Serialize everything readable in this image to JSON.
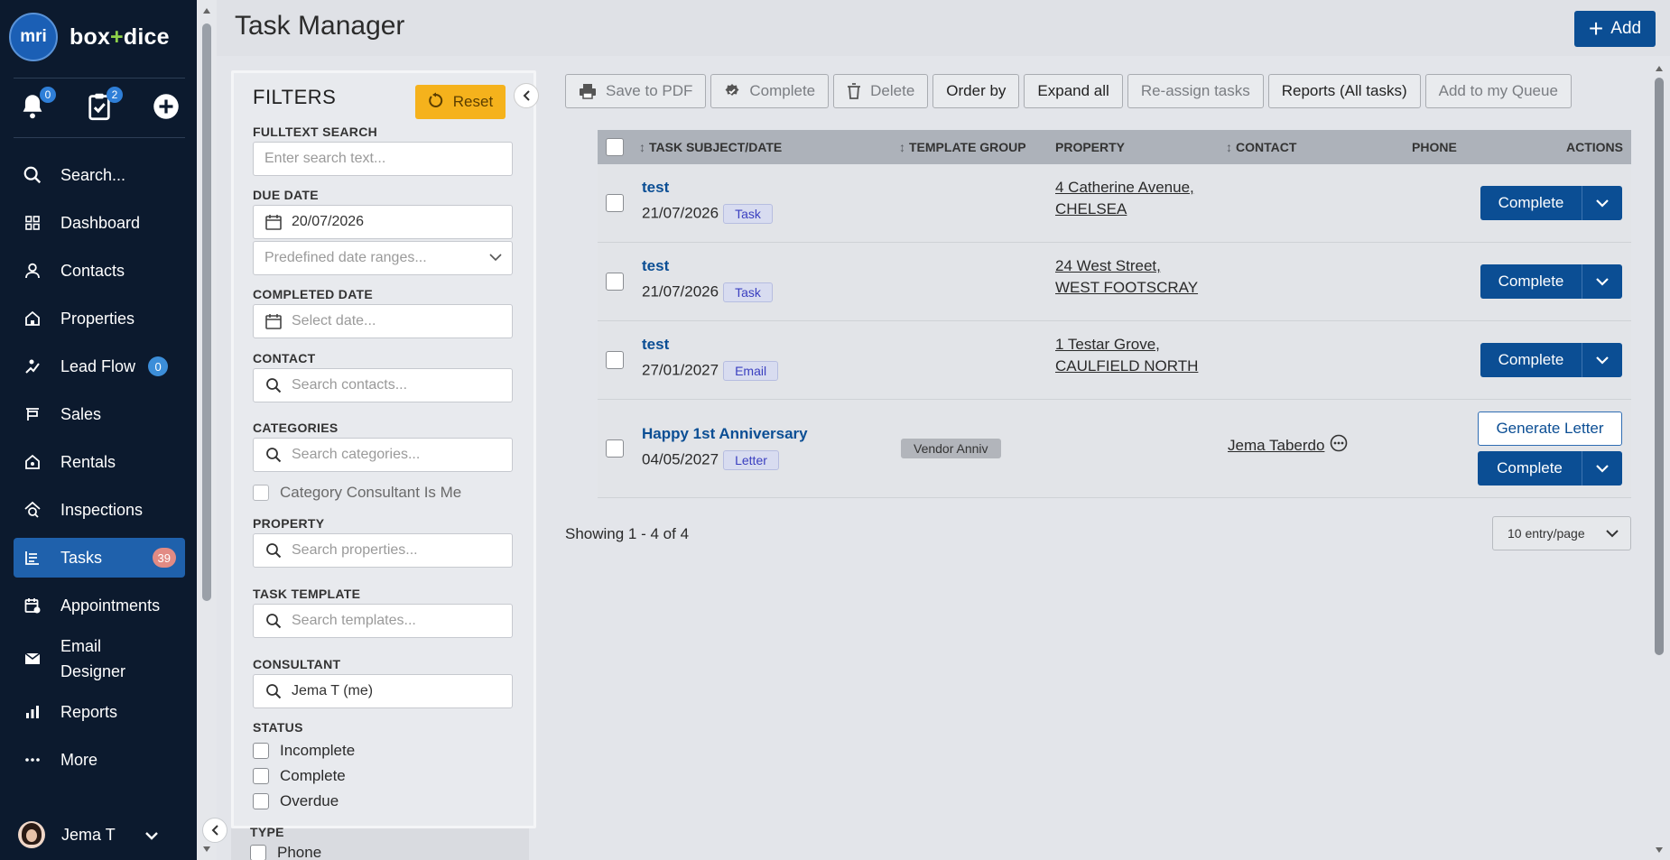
{
  "brand": {
    "logo_text": "mri",
    "name_left": "box",
    "name_plus": "+",
    "name_right": "dice"
  },
  "quick": {
    "notifications_count": "0",
    "tasks_count": "2"
  },
  "nav": [
    {
      "label": "Search...",
      "icon": "search-icon"
    },
    {
      "label": "Dashboard",
      "icon": "dashboard-icon"
    },
    {
      "label": "Contacts",
      "icon": "contacts-icon"
    },
    {
      "label": "Properties",
      "icon": "properties-icon"
    },
    {
      "label": "Lead Flow",
      "icon": "lead-flow-icon",
      "badge": "0"
    },
    {
      "label": "Sales",
      "icon": "sales-icon"
    },
    {
      "label": "Rentals",
      "icon": "rentals-icon"
    },
    {
      "label": "Inspections",
      "icon": "inspections-icon"
    },
    {
      "label": "Tasks",
      "icon": "tasks-icon",
      "badge": "39",
      "active": true
    },
    {
      "label": "Appointments",
      "icon": "appointments-icon"
    },
    {
      "label": "Email Designer",
      "icon": "email-icon"
    },
    {
      "label": "Reports",
      "icon": "reports-icon"
    },
    {
      "label": "More",
      "icon": "more-icon"
    }
  ],
  "user": {
    "name": "Jema T"
  },
  "header": {
    "title": "Task Manager",
    "add_label": "Add"
  },
  "filters": {
    "title": "FILTERS",
    "reset_label": "Reset",
    "fulltext_label": "FULLTEXT SEARCH",
    "fulltext_placeholder": "Enter search text...",
    "due_date_label": "DUE DATE",
    "due_date_value": "20/07/2026",
    "date_range_placeholder": "Predefined date ranges...",
    "completed_date_label": "COMPLETED DATE",
    "completed_date_placeholder": "Select date...",
    "contact_label": "CONTACT",
    "contact_placeholder": "Search contacts...",
    "categories_label": "CATEGORIES",
    "categories_placeholder": "Search categories...",
    "category_consultant_label": "Category Consultant Is Me",
    "property_label": "PROPERTY",
    "property_placeholder": "Search properties...",
    "template_label": "TASK TEMPLATE",
    "template_placeholder": "Search templates...",
    "consultant_label": "CONSULTANT",
    "consultant_value": "Jema T (me)",
    "status_label": "STATUS",
    "status_options": [
      "Incomplete",
      "Complete",
      "Overdue"
    ],
    "type_label": "TYPE",
    "type_options": [
      "Phone"
    ]
  },
  "toolbar": {
    "save_pdf": "Save to PDF",
    "complete": "Complete",
    "delete": "Delete",
    "order_by": "Order by",
    "expand_all": "Expand all",
    "reassign": "Re-assign tasks",
    "reports": "Reports (All tasks)",
    "add_queue": "Add to my Queue"
  },
  "table": {
    "columns": [
      "TASK SUBJECT/DATE",
      "TEMPLATE GROUP",
      "PROPERTY",
      "CONTACT",
      "PHONE",
      "ACTIONS"
    ],
    "rows": [
      {
        "subject": "test",
        "date": "21/07/2026",
        "type": "Task",
        "template_group": "",
        "property_line1": "4 Catherine Avenue,",
        "property_line2": "CHELSEA",
        "contact": "",
        "phone": "",
        "action": "Complete"
      },
      {
        "subject": "test",
        "date": "21/07/2026",
        "type": "Task",
        "template_group": "",
        "property_line1": "24 West Street,",
        "property_line2": "WEST FOOTSCRAY",
        "contact": "",
        "phone": "",
        "action": "Complete"
      },
      {
        "subject": "test",
        "date": "27/01/2027",
        "type": "Email",
        "template_group": "",
        "property_line1": "1 Testar Grove,",
        "property_line2": "CAULFIELD NORTH",
        "contact": "",
        "phone": "",
        "action": "Complete"
      },
      {
        "subject": "Happy 1st Anniversary",
        "date": "04/05/2027",
        "type": "Letter",
        "template_group": "Vendor Anniv",
        "property_line1": "",
        "property_line2": "",
        "contact": "Jema Taberdo",
        "phone": "",
        "action": "Complete",
        "extra_action": "Generate Letter"
      }
    ]
  },
  "pagination": {
    "showing": "Showing 1 - 4 of 4",
    "per_page": "10 entry/page"
  }
}
